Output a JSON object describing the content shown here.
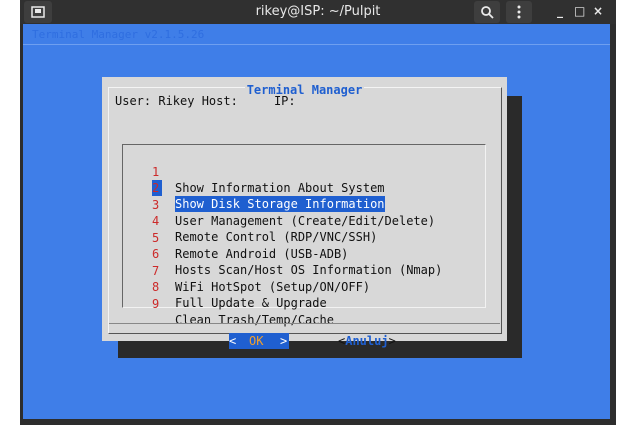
{
  "window": {
    "title": "rikey@ISP: ~/Pulpit",
    "controls": {
      "minimize": "_",
      "maximize": "□",
      "close": "×"
    }
  },
  "terminal": {
    "backtitle": "Terminal Manager v2.1.5.26"
  },
  "dialog": {
    "title": "Terminal Manager",
    "info": "User: Rikey Host:     IP:",
    "items": [
      {
        "num": "1",
        "label": "Show Information About System"
      },
      {
        "num": "2",
        "label": "Show Disk Storage Information"
      },
      {
        "num": "3",
        "label": "User Management (Create/Edit/Delete)"
      },
      {
        "num": "4",
        "label": "Remote Control (RDP/VNC/SSH)"
      },
      {
        "num": "5",
        "label": "Remote Android (USB-ADB)"
      },
      {
        "num": "6",
        "label": "Hosts Scan/Host OS Information (Nmap)"
      },
      {
        "num": "7",
        "label": "WiFi HotSpot (Setup/ON/OFF)"
      },
      {
        "num": "8",
        "label": "Full Update & Upgrade"
      },
      {
        "num": "9",
        "label": "Clean Trash/Temp/Cache"
      }
    ],
    "selected_index": 1,
    "ok_button": {
      "left": "<",
      "label": "OK",
      "right": ">"
    },
    "cancel_button": {
      "left": "<",
      "label": "Anuluj",
      "right": ">"
    }
  },
  "colors": {
    "terminal_bg": "#3f7ee8",
    "dialog_bg": "#d8d8d8",
    "accent": "#1f5fd0",
    "item_number": "#cc2a2a",
    "ok_label": "#f0a030"
  },
  "icons": {
    "app": "terminal-icon",
    "search": "search-icon",
    "menu": "menu-icon"
  }
}
